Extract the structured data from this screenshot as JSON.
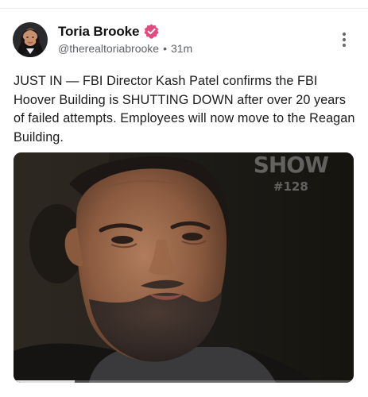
{
  "post": {
    "author": {
      "display_name": "Toria Brooke",
      "handle": "@therealtoriabrooke",
      "verified": true,
      "verified_color": "#e2497c",
      "avatar_icon": "profile-photo"
    },
    "separator": "•",
    "timestamp": "31m",
    "more_icon": "vertical-ellipsis",
    "text": "JUST IN — FBI Director Kash Patel confirms the FBI Hoover Building is SHUTTING DOWN after over 20 years of failed attempts. Employees will now move to the Reagan Building.",
    "media": {
      "type": "video",
      "watermark_line1": "SHOW",
      "watermark_line2": "#128",
      "progress": 0.18
    }
  }
}
